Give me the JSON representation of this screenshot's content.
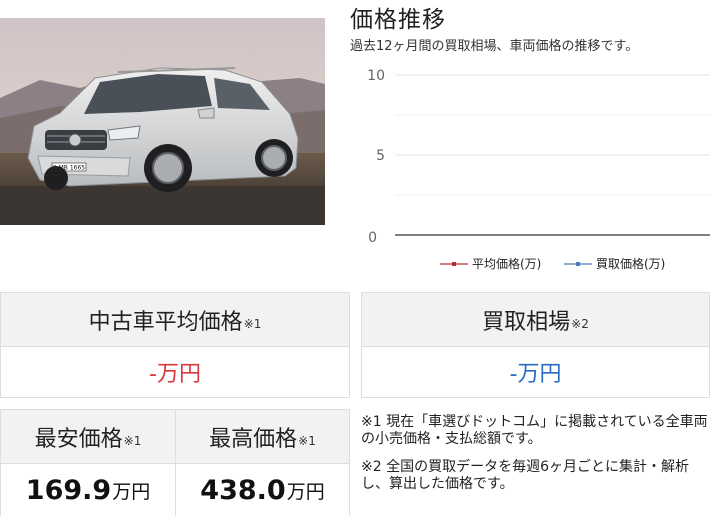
{
  "chart": {
    "title": "価格推移",
    "subtitle": "過去12ヶ月間の買取相場、車両価格の推移です。",
    "legend": [
      {
        "label": "平均価格(万)",
        "color": "#b03030"
      },
      {
        "label": "買取価格(万)",
        "color": "#4a7fb5"
      }
    ]
  },
  "chart_data": {
    "type": "line",
    "title": "価格推移",
    "subtitle": "過去12ヶ月間の買取相場、車両価格の推移です。",
    "y_ticks": [
      "10",
      "5",
      "0"
    ],
    "ylim": [
      0,
      10
    ],
    "series": [
      {
        "name": "平均価格(万)",
        "values": []
      },
      {
        "name": "買取価格(万)",
        "values": []
      }
    ],
    "grid": true,
    "legend_position": "bottom-right"
  },
  "used_avg": {
    "label": "中古車平均価格",
    "note": "※1",
    "value": "-万円"
  },
  "buy_market": {
    "label": "買取相場",
    "note": "※2",
    "value": "-万円"
  },
  "min_price": {
    "label": "最安価格",
    "note": "※1",
    "value": "169.9",
    "unit": "万円"
  },
  "max_price": {
    "label": "最高価格",
    "note": "※1",
    "value": "438.0",
    "unit": "万円"
  },
  "notes": {
    "note1": "※1 現在「車選びドットコム」に掲載されている全車両の小売価格・支払総額です。",
    "note2": "※2 全国の買取データを毎週6ヶ月ごとに集計・解析し、算出した価格です。"
  },
  "car_plate": "S-MB 1665"
}
